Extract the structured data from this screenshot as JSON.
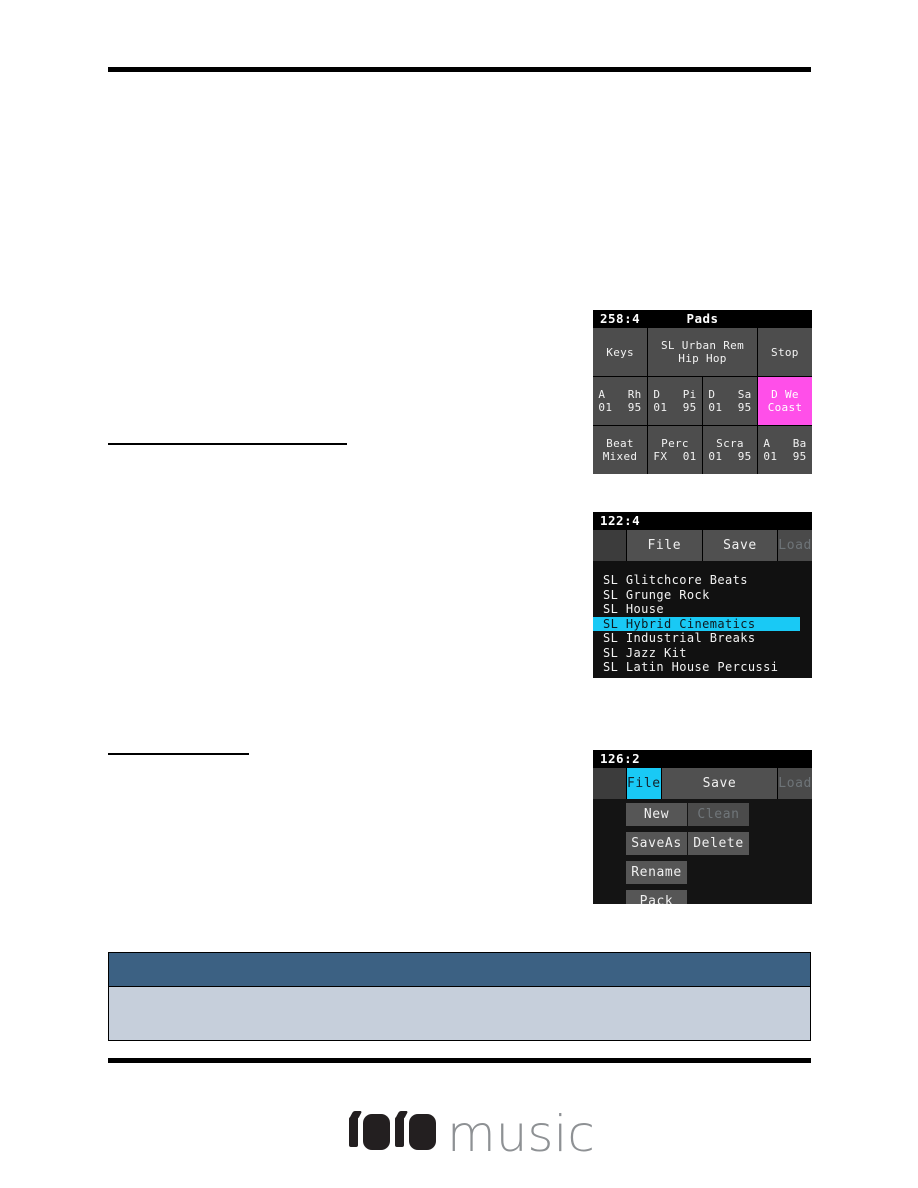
{
  "page": {
    "background_color": "#ffffff",
    "rule_color": "#000000"
  },
  "screens": {
    "pads": {
      "name": "Pads",
      "titlebar": {
        "clock": "258:4",
        "title": "Pads"
      },
      "colors": {
        "pad_bg": "#4d4d4d",
        "pad_active_bg": "#ff4fe9",
        "screen_bg": "#1b1b1b"
      },
      "rows": [
        [
          {
            "label_lines": [
              "Keys"
            ],
            "width": 1,
            "active": false
          },
          {
            "label_lines": [
              "SL Urban Rem",
              "Hip Hop"
            ],
            "width": 2,
            "active": false
          },
          {
            "label_lines": [
              "Stop"
            ],
            "width": 1,
            "active": false
          }
        ],
        [
          {
            "split_lines": [
              [
                "A",
                "Rh"
              ],
              [
                "01",
                "95"
              ]
            ],
            "width": 1,
            "active": false
          },
          {
            "split_lines": [
              [
                "D",
                "Pi"
              ],
              [
                "01",
                "95"
              ]
            ],
            "width": 1,
            "active": false
          },
          {
            "split_lines": [
              [
                "D",
                "Sa"
              ],
              [
                "01",
                "95"
              ]
            ],
            "width": 1,
            "active": false
          },
          {
            "label_lines": [
              "D We",
              "Coast"
            ],
            "width": 1,
            "active": true
          }
        ],
        [
          {
            "label_lines": [
              "Beat",
              "Mixed"
            ],
            "width": 1,
            "active": false
          },
          {
            "split_lines": [
              [
                "Perc"
              ],
              [
                "FX",
                "01"
              ]
            ],
            "width": 1,
            "active": false
          },
          {
            "split_lines": [
              [
                "Scra"
              ],
              [
                "01",
                "95"
              ]
            ],
            "width": 1,
            "active": false
          },
          {
            "split_lines": [
              [
                "A",
                "Ba"
              ],
              [
                "01",
                "95"
              ]
            ],
            "width": 1,
            "active": false
          }
        ]
      ],
      "pad_labels": {
        "r1c1": "Keys",
        "r1c2_line1": "SL Urban Rem",
        "r1c2_line2": "Hip Hop",
        "r1c3": "Stop",
        "r2c1_l1a": "A",
        "r2c1_l1b": "Rh",
        "r2c1_l2a": "01",
        "r2c1_l2b": "95",
        "r2c2_l1a": "D",
        "r2c2_l1b": "Pi",
        "r2c2_l2a": "01",
        "r2c2_l2b": "95",
        "r2c3_l1a": "D",
        "r2c3_l1b": "Sa",
        "r2c3_l2a": "01",
        "r2c3_l2b": "95",
        "r2c4_l1": "D We",
        "r2c4_l2": "Coast",
        "r3c1_l1": "Beat",
        "r3c1_l2": "Mixed",
        "r3c2_l1": "Perc",
        "r3c2_l2a": "FX",
        "r3c2_l2b": "01",
        "r3c3_l1": "Scra",
        "r3c3_l2a": "01",
        "r3c3_l2b": "95",
        "r3c4_l1a": "A",
        "r3c4_l1b": "Ba",
        "r3c4_l2a": "01",
        "r3c4_l2b": "95"
      }
    },
    "file_list": {
      "titlebar": {
        "clock": "122:4"
      },
      "tabs": [
        {
          "label": "",
          "state": "blank"
        },
        {
          "label": "File",
          "state": "normal"
        },
        {
          "label": "Save",
          "state": "normal"
        },
        {
          "label": "Load",
          "state": "disabled"
        }
      ],
      "tab_labels": {
        "blank": "",
        "file": "File",
        "save": "Save",
        "load": "Load"
      },
      "items": [
        {
          "label": "SL Glitchcore Beats",
          "selected": false
        },
        {
          "label": "SL Grunge Rock",
          "selected": false
        },
        {
          "label": "SL House",
          "selected": false
        },
        {
          "label": "SL Hybrid Cinematics",
          "selected": true
        },
        {
          "label": "SL Industrial Breaks",
          "selected": false
        },
        {
          "label": "SL Jazz Kit",
          "selected": false
        },
        {
          "label": "SL Latin House Percussi",
          "selected": false
        }
      ],
      "selection_color": "#19c9f5"
    },
    "file_menu": {
      "titlebar": {
        "clock": "126:2"
      },
      "tabs": [
        {
          "label": "",
          "state": "blank"
        },
        {
          "label": "File",
          "state": "selected"
        },
        {
          "label": "Save",
          "state": "normal"
        },
        {
          "label": "Load",
          "state": "disabled"
        }
      ],
      "tab_labels": {
        "blank": "",
        "file": "File",
        "save": "Save",
        "load": "Load"
      },
      "buttons": {
        "new": "New",
        "clean": "Clean",
        "save_as": "SaveAs",
        "delete": "Delete",
        "rename": "Rename",
        "pack": "Pack"
      },
      "disabled_buttons": [
        "Clean",
        "Load"
      ],
      "selection_color": "#19c9f5"
    }
  },
  "bottom_table": {
    "header_color": "#3c6183",
    "body_color": "#c6cfdb",
    "header_text": "",
    "body_text": ""
  },
  "footer": {
    "logo": {
      "digits": "1010",
      "word": "music"
    }
  }
}
